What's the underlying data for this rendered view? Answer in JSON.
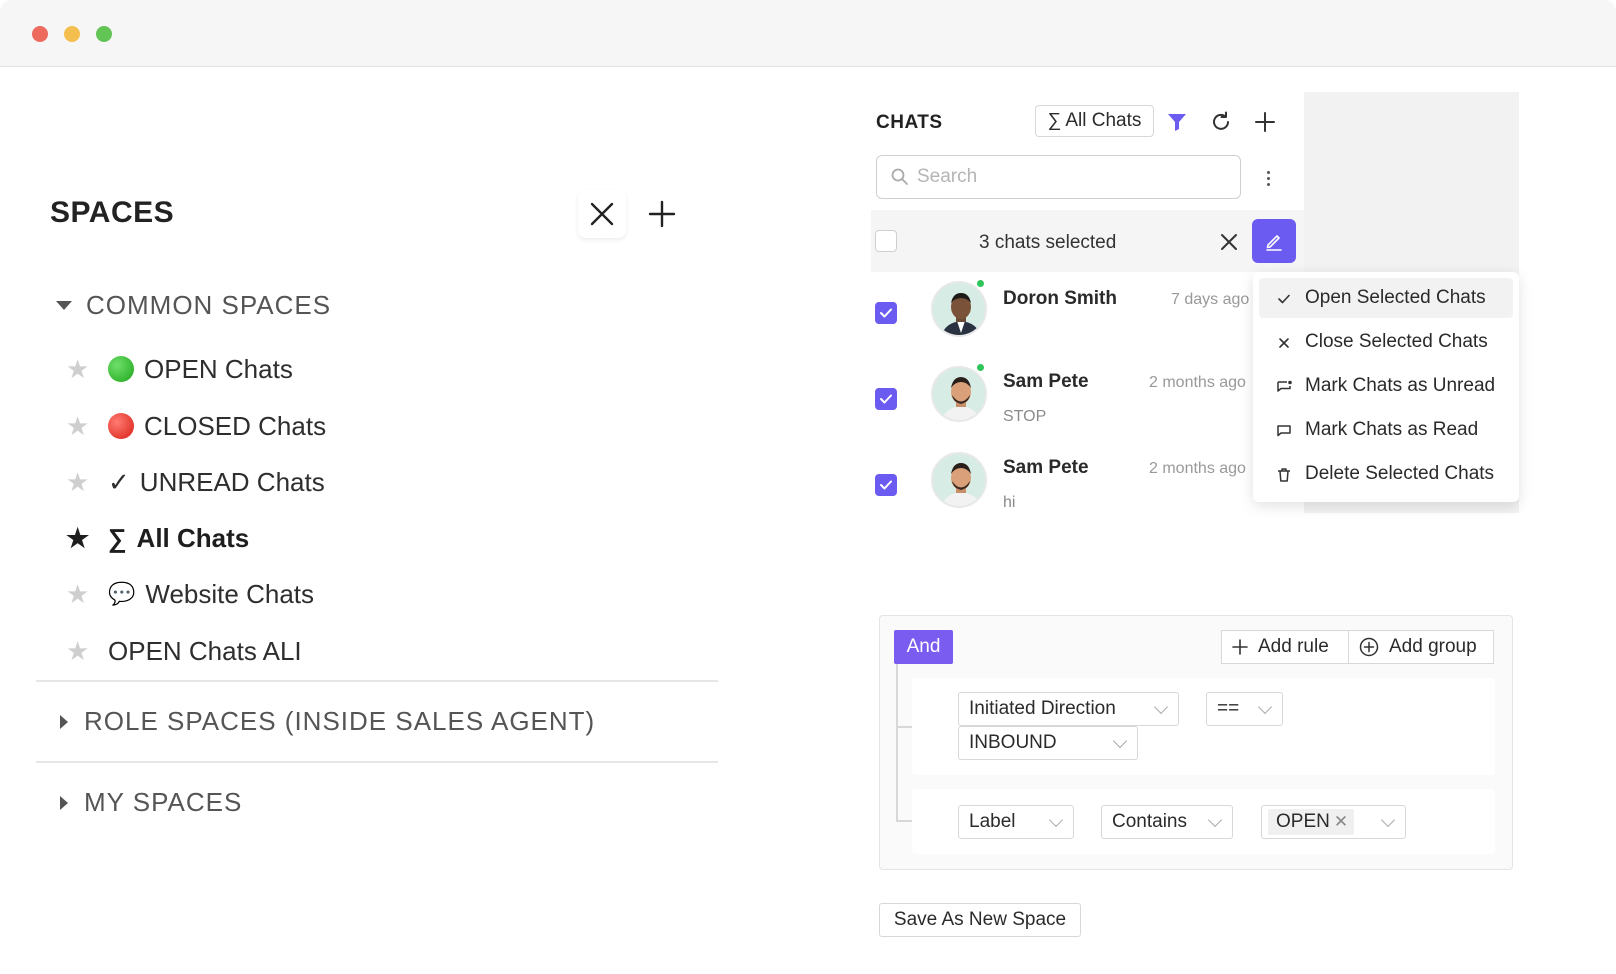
{
  "spaces": {
    "title": "SPACES",
    "sections": [
      {
        "label": "COMMON SPACES",
        "items": [
          {
            "prefix": "",
            "label": "OPEN Chats"
          },
          {
            "prefix": "",
            "label": "CLOSED Chats"
          },
          {
            "prefix": "✓",
            "label": "UNREAD Chats"
          },
          {
            "prefix": "∑",
            "label": "All Chats"
          },
          {
            "prefix": "💬",
            "label": "Website Chats"
          },
          {
            "prefix": "",
            "label": "OPEN Chats ALI"
          }
        ]
      },
      {
        "label": "ROLE SPACES (INSIDE SALES AGENT)"
      },
      {
        "label": "MY SPACES"
      }
    ]
  },
  "chats": {
    "title": "CHATS",
    "filter_label": "∑ All Chats",
    "search_placeholder": "Search",
    "selected_text": "3 chats selected",
    "rows": [
      {
        "name": "Doron Smith",
        "time": "7 days ago",
        "message": ""
      },
      {
        "name": "Sam Pete",
        "time": "2 months ago",
        "message": "STOP"
      },
      {
        "name": "Sam Pete",
        "time": "2 months ago",
        "message": "hi"
      }
    ]
  },
  "menu": {
    "items": [
      {
        "label": "Open Selected Chats",
        "icon": "check-icon"
      },
      {
        "label": "Close Selected Chats",
        "icon": "close-icon"
      },
      {
        "label": "Mark Chats as Unread",
        "icon": "unread-icon"
      },
      {
        "label": "Mark Chats as Read",
        "icon": "read-icon"
      },
      {
        "label": "Delete Selected Chats",
        "icon": "trash-icon"
      }
    ]
  },
  "query": {
    "combinator": "And",
    "add_rule": "Add rule",
    "add_group": "Add group",
    "rule1": {
      "field": "Initiated Direction",
      "operator": "==",
      "value": "INBOUND"
    },
    "rule2": {
      "field": "Label",
      "operator": "Contains",
      "value": "OPEN"
    },
    "save_label": "Save As New Space"
  },
  "colors": {
    "accent": "#6b5bf0",
    "online": "#2fc55a"
  }
}
